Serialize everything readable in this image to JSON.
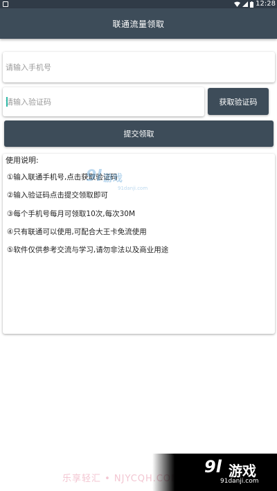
{
  "status_bar": {
    "time": "12:28"
  },
  "toolbar": {
    "title": "联通流量领取"
  },
  "form": {
    "phone_placeholder": "请输入手机号",
    "code_placeholder": "请输入验证码",
    "get_code_label": "获取验证码",
    "submit_label": "提交领取"
  },
  "instructions": {
    "title": "使用说明:",
    "items": [
      "①输入联通手机号,点击获取验证码",
      "②输入验证码点击提交领取即可",
      "③每个手机号每月可领取10次,每次30M",
      "④只有联通可以使用,可配合大王卡免流使用",
      "⑤软件仅供参考交流与学习,请勿非法以及商业用途"
    ]
  },
  "watermarks": {
    "top_logo": "9l",
    "top_text": "游戏",
    "top_url": "91danji.com",
    "bottom_text": "乐享轻汇 • NJYCQH.COM",
    "banner_logo": "9l",
    "banner_text": "游戏",
    "banner_url": "91danji.com"
  },
  "colors": {
    "toolbar": "#3d4c59",
    "status_bar": "#303b47",
    "button": "#3d4c59",
    "cursor": "#2fb8a6"
  }
}
